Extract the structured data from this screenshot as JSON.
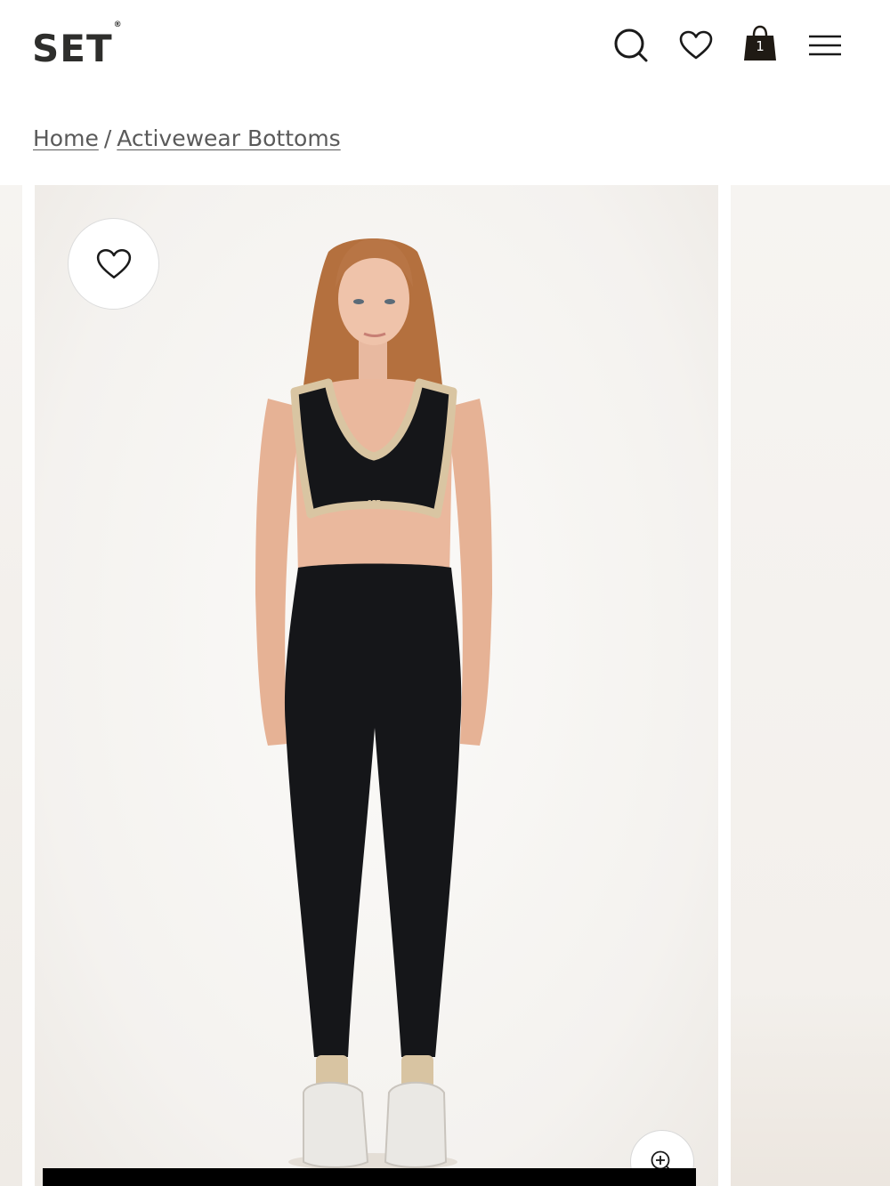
{
  "header": {
    "logo": "SET",
    "logo_mark": "®",
    "icons": {
      "search": "search-icon",
      "wishlist": "heart-icon",
      "bag": "shopping-bag-icon",
      "menu": "hamburger-menu-icon"
    },
    "bag_count": "1"
  },
  "breadcrumb": {
    "items": [
      {
        "label": "Home"
      },
      {
        "label": "Activewear Bottoms"
      }
    ],
    "separator": "/"
  },
  "gallery": {
    "wishlist_icon": "heart-icon",
    "zoom_icon": "zoom-in-icon",
    "bra_print": "SET"
  },
  "colors": {
    "brand_text": "#2e2e2c",
    "bag_fill": "#1f1a14",
    "garment_black": "#151619",
    "garment_trim": "#d9c5a2"
  }
}
